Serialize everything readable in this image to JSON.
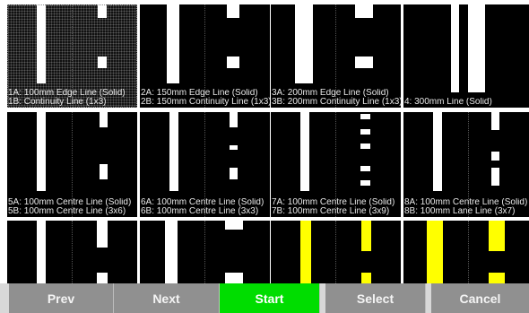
{
  "tiles": [
    {
      "line1": "1A: 100mm Edge Line (Solid)",
      "line2": "1B: Continuity Line (1x3)",
      "selected": true
    },
    {
      "line1": "2A: 150mm Edge Line (Solid)",
      "line2": "2B: 150mm Continuity Line (1x3)"
    },
    {
      "line1": "3A: 200mm Edge Line (Solid)",
      "line2": "3B: 200mm Continuity Line (1x3)"
    },
    {
      "line1": "",
      "line2": "4: 300mm Line (Solid)"
    },
    {
      "line1": "5A: 100mm Centre Line (Solid)",
      "line2": "5B: 100mm Centre Line (3x6)"
    },
    {
      "line1": "6A: 100mm Centre Line (Solid)",
      "line2": "6B: 100mm Centre Line (3x3)"
    },
    {
      "line1": "7A: 100mm Centre Line (Solid)",
      "line2": "7B: 100mm Centre Line (3x9)"
    },
    {
      "line1": "8A: 100mm Centre Line (Solid)",
      "line2": "8B: 100mm Lane Line (3x7)"
    },
    {
      "line1": "",
      "line2": ""
    },
    {
      "line1": "",
      "line2": ""
    },
    {
      "line1": "",
      "line2": ""
    },
    {
      "line1": "",
      "line2": ""
    }
  ],
  "colors": {
    "line_white": "#ffffff",
    "line_yellow": "#ffff00",
    "button_gray": "#909090",
    "button_active": "#00dd00"
  },
  "buttons": {
    "prev": "Prev",
    "next": "Next",
    "start": "Start",
    "select": "Select",
    "cancel": "Cancel"
  }
}
